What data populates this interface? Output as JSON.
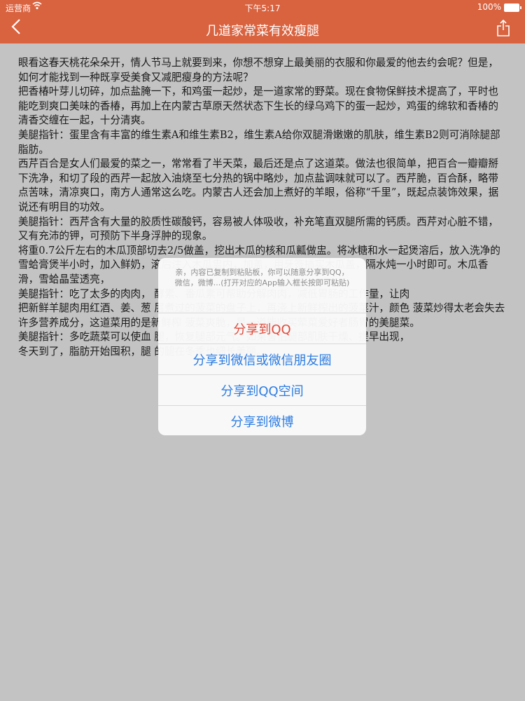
{
  "status_bar": {
    "carrier": "运营商",
    "time": "下午5:17",
    "battery": "100%"
  },
  "nav": {
    "title": "几道家常菜有效瘦腿",
    "back_icon": "chevron-left-icon",
    "share_icon": "share-icon"
  },
  "article": {
    "paragraphs": [
      "眼看这春天桃花朵朵开，情人节马上就要到来，你想不想穿上最美丽的衣服和你最爱的他去约会呢？但是，如何才能找到一种既享受美食又减肥瘦身的方法呢？",
      "把香椿叶芽儿切碎，加点盐腌一下，和鸡蛋一起炒，是一道家常的野菜。现在食物保鲜技术提高了，平时也能吃到爽口美味的香椿，再加上在内蒙古草原天然状态下生长的绿乌鸡下的蛋一起炒，鸡蛋的绵软和香椿的清香交缠在一起，十分清爽。",
      "美腿指针：蛋里含有丰富的维生素A和维生素B2，维生素A给你双腿滑嫩嫩的肌肤，维生素B2则可消除腿部脂肪。",
      "西芹百合是女人们最爱的菜之一，常常看了半天菜，最后还是点了这道菜。做法也很简单，把百合一瓣瓣掰下洗净，和切了段的西芹一起放入油烧至七分热的锅中略炒，加点盐调味就可以了。西芹脆，百合酥，略带点苦味，清凉爽口，南方人通常这么吃。内蒙古人还会加上煮好的羊眼，俗称“千里”，既起点装饰效果，据说还有明目的功效。",
      "美腿指针：西芹含有大量的胶质性碳酸钙，容易被人体吸收，补充笔直双腿所需的钙质。西芹对心脏不错，又有充沛的钾，可预防下半身浮肿的现象。",
      "将重0.7公斤左右的木瓜顶部切去2/5做盖，挖出木瓜的核和瓜瓤做盅。将冰糖和水一起煲溶后，放入洗净的雪蛤膏煲半小时，加入鲜奶，滚后注入木瓜盅内，加盖，用牙签插实木瓜盖，隔水炖一小时即可。木瓜香滑，雪蛤晶莹透亮，",
      "美腿指针：吃了太多的肉肉，                                                            酵素、番瓜素可帮助分解肉肉，减低胃肠的工作量，让肉",
      "把新鲜羊腿肉用红酒、姜、葱                                                                层煮过的菠菜的盘子上，再浇上新鲜榨出的菠菜汁，颜色                                                    菠菜炒得太老会失去许多营养成分，这道菜用的是新鲜榨                                                      菠菜爽脆，是一道能收买荤菜爱好者肠胃的美腿菜。",
      "美腿指针：多吃蔬菜可以使血                                                                    腿，恢复腿部元气。如果害怕腿部肌肤干燥、提早出现，",
      "冬天到了，脂肪开始囤积，腿                                                                    的腿在冬季也细长美丽。"
    ]
  },
  "share_sheet": {
    "message": "亲，内容已复制到粘贴板，你可以随意分享到QQ，微信，微博...(打开对应的App输入框长按即可粘贴)",
    "options": [
      "分享到QQ",
      "分享到微信或微信朋友圈",
      "分享到QQ空间",
      "分享到微博"
    ],
    "colors": {
      "first": "#e04b3b",
      "others": "#2a7ce3"
    }
  },
  "colors": {
    "accent": "#d9623f"
  }
}
